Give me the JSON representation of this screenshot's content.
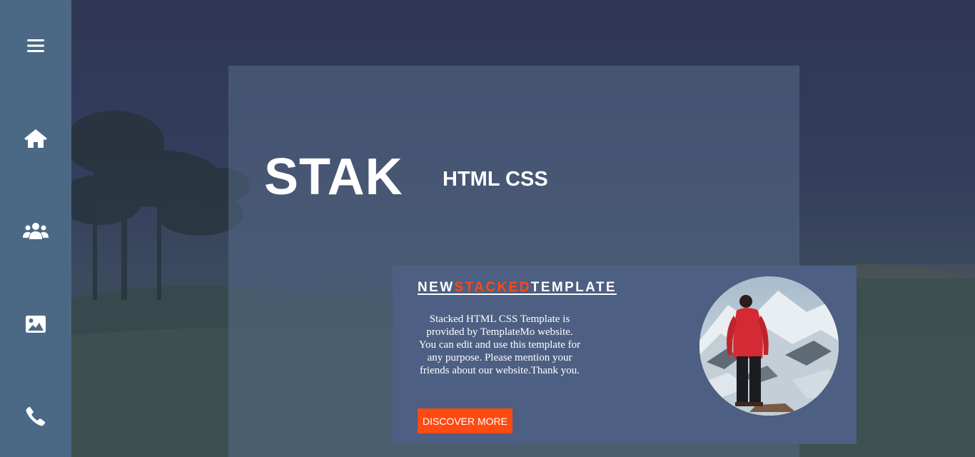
{
  "sidebar": {
    "items": [
      {
        "icon": "hamburger-menu-icon"
      },
      {
        "icon": "home-icon"
      },
      {
        "icon": "users-icon"
      },
      {
        "icon": "image-icon"
      },
      {
        "icon": "phone-icon"
      }
    ]
  },
  "hero": {
    "brand": "STAK",
    "subtitle": "HTML CSS"
  },
  "card": {
    "title_part1": "NEW",
    "title_part2": "STACKED",
    "title_part3": "TEMPLATE",
    "description": "Stacked HTML CSS Template is provided by TemplateMo website. You can edit and use this template for any purpose. Please mention your friends about our website.Thank you.",
    "button_label": "DISCOVER MORE"
  },
  "colors": {
    "sidebar": "#4b6985",
    "accent": "#ff4a12",
    "card": "#4d5f82"
  }
}
